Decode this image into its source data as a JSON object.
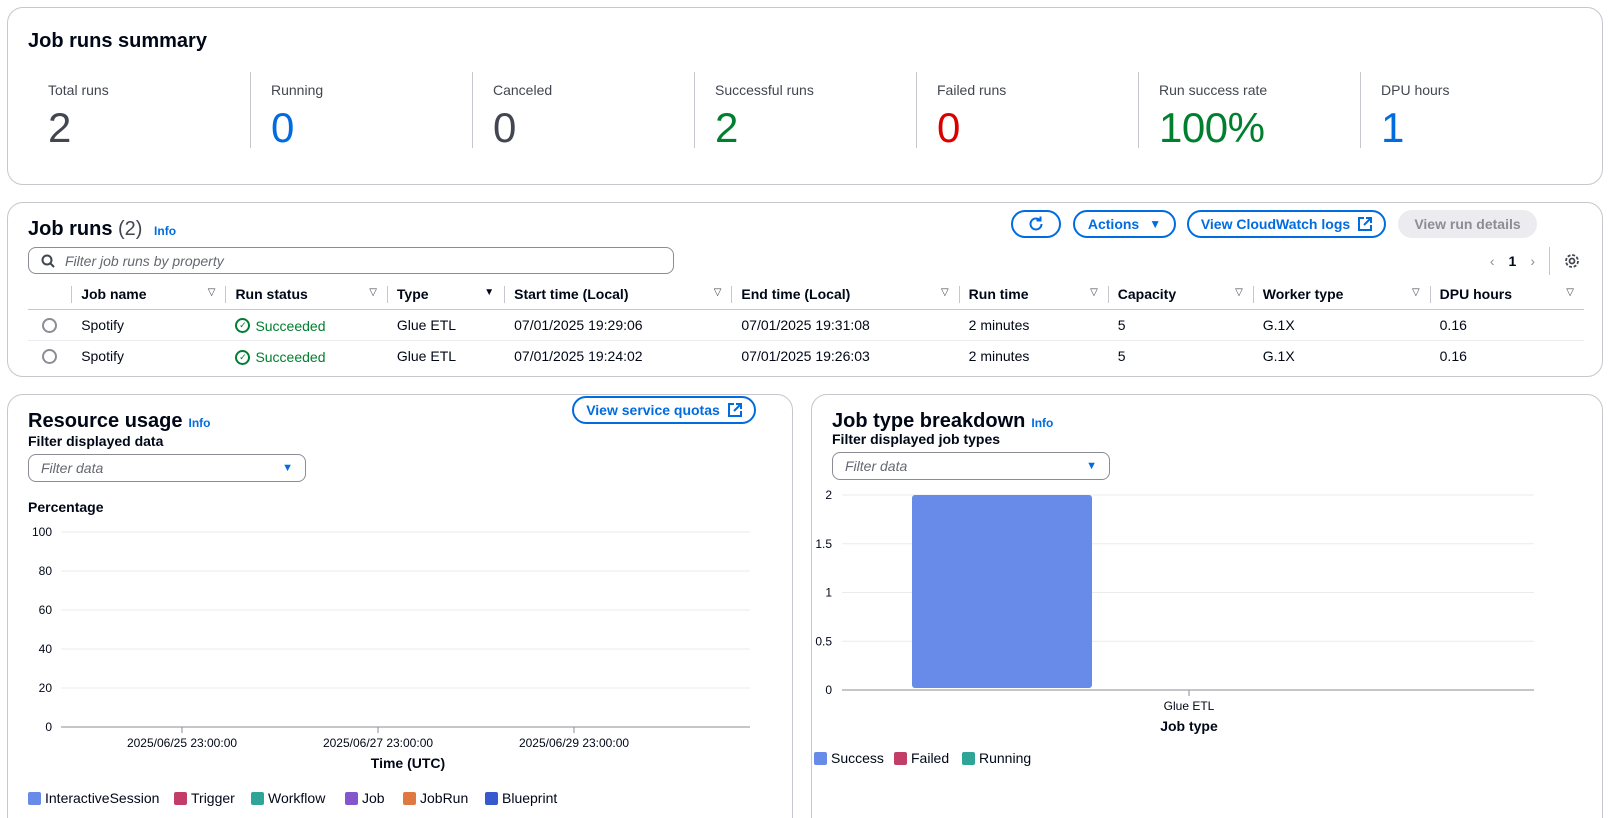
{
  "summary": {
    "title": "Job runs summary",
    "metrics": [
      {
        "label": "Total runs",
        "value": "2",
        "color": "#424650"
      },
      {
        "label": "Running",
        "value": "0",
        "color": "#006ce0"
      },
      {
        "label": "Canceled",
        "value": "0",
        "color": "#424650"
      },
      {
        "label": "Successful runs",
        "value": "2",
        "color": "#00802f"
      },
      {
        "label": "Failed runs",
        "value": "0",
        "color": "#db0000"
      },
      {
        "label": "Run success rate",
        "value": "100%",
        "color": "#00802f"
      },
      {
        "label": "DPU hours",
        "value": "1",
        "color": "#006ce0"
      }
    ]
  },
  "jobruns": {
    "title": "Job runs",
    "count": "(2)",
    "info": "Info",
    "refresh_icon": "refresh-icon",
    "actions_label": "Actions",
    "cloudwatch_label": "View CloudWatch logs",
    "run_details_label": "View run details",
    "search_placeholder": "Filter job runs by property",
    "page": "1",
    "columns": [
      "Job name",
      "Run status",
      "Type",
      "Start time (Local)",
      "End time (Local)",
      "Run time",
      "Capacity",
      "Worker type",
      "DPU hours"
    ],
    "rows": [
      {
        "job_name": "Spotify",
        "status": "Succeeded",
        "type": "Glue ETL",
        "start": "07/01/2025 19:29:06",
        "end": "07/01/2025 19:31:08",
        "run_time": "2 minutes",
        "capacity": "5",
        "worker": "G.1X",
        "dpu": "0.16"
      },
      {
        "job_name": "Spotify",
        "status": "Succeeded",
        "type": "Glue ETL",
        "start": "07/01/2025 19:24:02",
        "end": "07/01/2025 19:26:03",
        "run_time": "2 minutes",
        "capacity": "5",
        "worker": "G.1X",
        "dpu": "0.16"
      }
    ]
  },
  "resource": {
    "title": "Resource usage",
    "info": "Info",
    "quotas_label": "View service quotas",
    "filter_label": "Filter displayed data",
    "filter_placeholder": "Filter data",
    "legend": [
      {
        "name": "InteractiveSession",
        "color": "#688ae8"
      },
      {
        "name": "Trigger",
        "color": "#c33d69"
      },
      {
        "name": "Workflow",
        "color": "#2ea597"
      },
      {
        "name": "Job",
        "color": "#8456ce"
      },
      {
        "name": "JobRun",
        "color": "#e07941"
      },
      {
        "name": "Blueprint",
        "color": "#3759ce"
      }
    ]
  },
  "jobtype": {
    "title": "Job type breakdown",
    "info": "Info",
    "filter_label": "Filter displayed job types",
    "filter_placeholder": "Filter data",
    "legend": [
      {
        "name": "Success",
        "color": "#688ae8"
      },
      {
        "name": "Failed",
        "color": "#c33d69"
      },
      {
        "name": "Running",
        "color": "#2ea597"
      }
    ]
  },
  "chart_data": [
    {
      "type": "line",
      "title": "",
      "ylabel": "Percentage",
      "xlabel": "Time (UTC)",
      "ylim": [
        0,
        100
      ],
      "yticks": [
        "100",
        "80",
        "60",
        "40",
        "20",
        "0"
      ],
      "xticks": [
        "2025/06/25 23:00:00",
        "2025/06/27 23:00:00",
        "2025/06/29 23:00:00"
      ],
      "series": []
    },
    {
      "type": "bar",
      "title": "",
      "xlabel": "Job type",
      "ylabel": "",
      "categories": [
        "Glue ETL"
      ],
      "ylim": [
        0,
        2
      ],
      "yticks": [
        "2",
        "1.5",
        "1",
        "0.5",
        "0"
      ],
      "series": [
        {
          "name": "Success",
          "values": [
            2
          ],
          "color": "#688ae8"
        },
        {
          "name": "Failed",
          "values": [
            0
          ],
          "color": "#c33d69"
        },
        {
          "name": "Running",
          "values": [
            0
          ],
          "color": "#2ea597"
        }
      ]
    }
  ]
}
